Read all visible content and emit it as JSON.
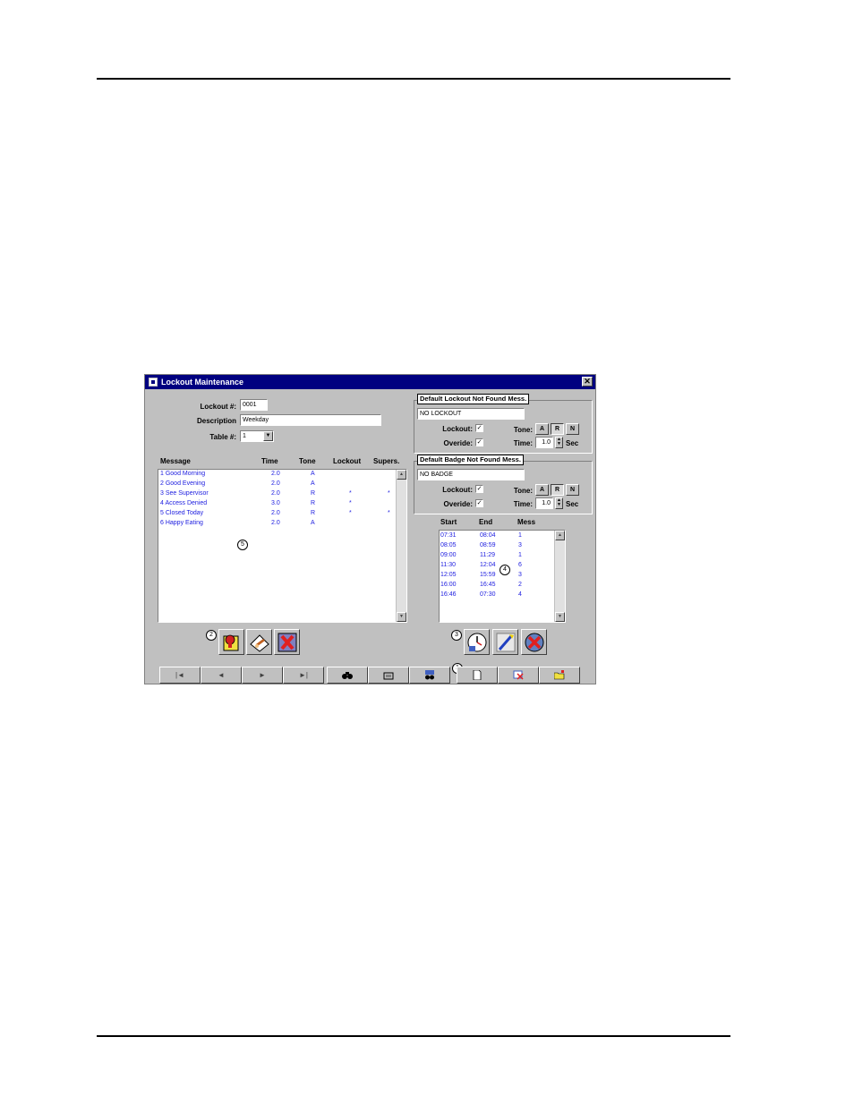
{
  "window": {
    "title": "Lockout Maintenance",
    "close_glyph": "✕"
  },
  "form": {
    "lockout_label": "Lockout #:",
    "lockout_value": "0001",
    "description_label": "Description",
    "description_value": "Weekday",
    "table_label": "Table #:",
    "table_value": "1"
  },
  "message_table": {
    "headers": [
      "Message",
      "Time",
      "Tone",
      "Lockout",
      "Supers."
    ],
    "rows": [
      {
        "message": "1 Good Morning",
        "time": "2.0",
        "tone": "A",
        "lockout": "",
        "supers": ""
      },
      {
        "message": "2 Good Evening",
        "time": "2.0",
        "tone": "A",
        "lockout": "",
        "supers": ""
      },
      {
        "message": "3 See Supervisor",
        "time": "2.0",
        "tone": "R",
        "lockout": "*",
        "supers": "*"
      },
      {
        "message": "4 Access Denied",
        "time": "3.0",
        "tone": "R",
        "lockout": "*",
        "supers": ""
      },
      {
        "message": "5 Closed Today",
        "time": "2.0",
        "tone": "R",
        "lockout": "*",
        "supers": "*"
      },
      {
        "message": "6 Happy Eating",
        "time": "2.0",
        "tone": "A",
        "lockout": "",
        "supers": ""
      }
    ]
  },
  "lockout_group": {
    "title": "Default Lockout Not Found Mess.",
    "message": "NO LOCKOUT",
    "lockout_label": "Lockout:",
    "override_label": "Overide:",
    "tone_label": "Tone:",
    "time_label": "Time:",
    "time_value": "1.0",
    "sec_label": "Sec",
    "tones": [
      "A",
      "R",
      "N"
    ]
  },
  "badge_group": {
    "title": "Default Badge Not Found Mess.",
    "message": "NO BADGE",
    "lockout_label": "Lockout:",
    "override_label": "Overide:",
    "tone_label": "Tone:",
    "time_label": "Time:",
    "time_value": "1.0",
    "sec_label": "Sec",
    "tones": [
      "A",
      "R",
      "N"
    ]
  },
  "schedule_table": {
    "headers": [
      "Start",
      "End",
      "Mess"
    ],
    "rows": [
      {
        "start": "07:31",
        "end": "08:04",
        "mess": "1"
      },
      {
        "start": "08:05",
        "end": "08:59",
        "mess": "3"
      },
      {
        "start": "09:00",
        "end": "11:29",
        "mess": "1"
      },
      {
        "start": "11:30",
        "end": "12:04",
        "mess": "6"
      },
      {
        "start": "12:05",
        "end": "15:59",
        "mess": "3"
      },
      {
        "start": "16:00",
        "end": "16:45",
        "mess": "2"
      },
      {
        "start": "16:46",
        "end": "07:30",
        "mess": "4"
      }
    ]
  },
  "callouts": {
    "c1": "1",
    "c2": "2",
    "c3": "3",
    "c4": "4",
    "c5": "5"
  },
  "glyphs": {
    "check": "✓",
    "arrow_down": "▼",
    "arrow_up": "▲",
    "nav_first": "|◄",
    "nav_prev": "◄",
    "nav_next": "►",
    "nav_last": "►|"
  },
  "colors": {
    "titlebar": "#000080",
    "list_text": "#2020e0",
    "face": "#c0c0c0"
  }
}
